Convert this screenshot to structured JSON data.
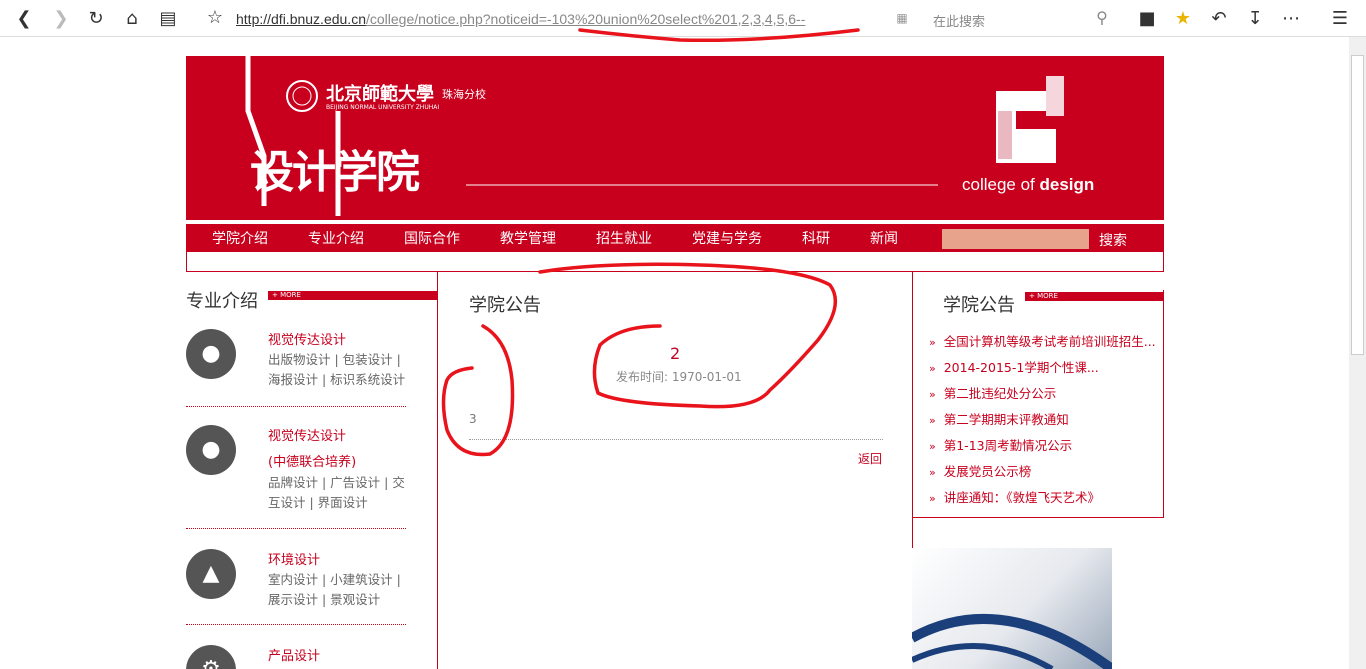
{
  "browser": {
    "url_domain": "http://dfi.bnuz.edu.cn",
    "url_path": "/college/notice.php?noticeid=-103%20union%20select%201,2,3,4,5,6--",
    "search_placeholder": "在此搜索"
  },
  "header": {
    "logo_cn": "北京師範大學",
    "logo_campus": "珠海分校",
    "logo_en": "BEIJING NORMAL UNIVERSITY ZHUHAI",
    "college_cn": "设计学院",
    "college_en_prefix": "college of ",
    "college_en_bold": "design"
  },
  "nav": {
    "items": [
      "学院介绍",
      "专业介绍",
      "国际合作",
      "教学管理",
      "招生就业",
      "党建与学务",
      "科研",
      "新闻"
    ],
    "search_label": "搜索"
  },
  "left": {
    "title": "专业介绍",
    "more": "+ MORE",
    "categories": [
      {
        "icon": "camera-icon",
        "name": "视觉传达设计",
        "sub": "出版物设计 | 包装设计 | 海报设计 | 标识系统设计"
      },
      {
        "icon": "camera-icon",
        "name": "视觉传达设计",
        "name2": "(中德联合培养)",
        "sub": "品牌设计 | 广告设计 | 交互设计 | 界面设计"
      },
      {
        "icon": "tree-icon",
        "name": "环境设计",
        "sub": "室内设计 | 小建筑设计 | 展示设计 | 景观设计"
      },
      {
        "icon": "gear-icon",
        "name": "产品设计"
      }
    ]
  },
  "center": {
    "title": "学院公告",
    "notice_title": "2",
    "notice_date": "发布时间: 1970-01-01",
    "notice_body": "3",
    "back": "返回"
  },
  "right": {
    "title": "学院公告",
    "more": "+ MORE",
    "items": [
      "全国计算机等级考试考前培训班招生...",
      "2014-2015-1学期个性课...",
      "第二批违纪处分公示",
      "第二学期期末评教通知",
      "第1-13周考勤情况公示",
      "发展党员公示榜",
      "讲座通知：《敦煌飞天艺术》"
    ]
  },
  "colors": {
    "brand": "#c8001e",
    "nav_search": "#e8a38c",
    "annotation": "#e8131b"
  }
}
